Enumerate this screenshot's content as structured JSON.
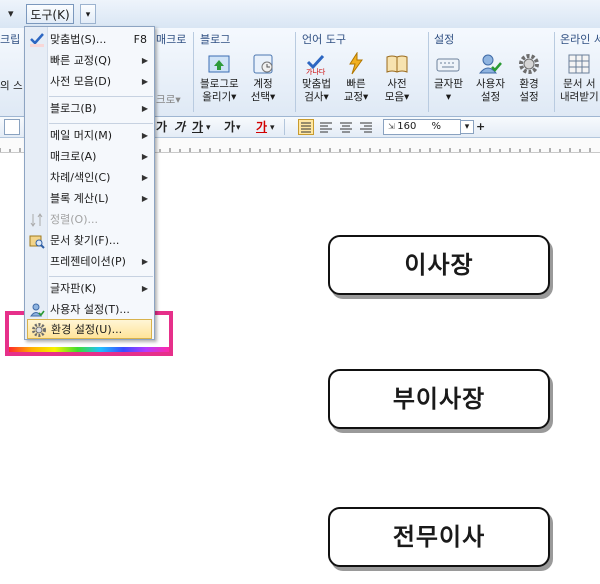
{
  "menubar": {
    "tool_menu": "도구(K)",
    "tool_drop": "▾",
    "left_arrow": "▾"
  },
  "ribbon": {
    "groups": {
      "script_partial": "크립",
      "macro_partial": "매크로",
      "blog": "블로그",
      "lang": "언어 도구",
      "settings": "설정",
      "online_partial": "온라인 서"
    },
    "partial_left_label": "의 스",
    "partial_macro_btn": "크로▾",
    "buttons": {
      "blog_post": [
        "블로그로",
        "올리기▾"
      ],
      "account": [
        "계정",
        "선택▾"
      ],
      "spell_check": [
        "맞춤법",
        "검사▾"
      ],
      "quick_fix": [
        "빠른",
        "교정▾"
      ],
      "dict": [
        "사전",
        "모음▾"
      ],
      "keyboard": [
        "글자판",
        "▾"
      ],
      "user_settings": [
        "사용자",
        "설정"
      ],
      "env_settings": [
        "환경",
        "설정"
      ],
      "doc_download": [
        "문서 서",
        "내려받기"
      ]
    }
  },
  "format_bar": {
    "ga1": "가",
    "ga2": "가",
    "ga_under": "가",
    "ga_dash": "가",
    "ga_red": "가",
    "zoom_value": "160",
    "zoom_unit": "%"
  },
  "dropdown": {
    "items": [
      {
        "label": "맞춤법(S)...",
        "shortcut": "F8",
        "icon": "spell-check-icon"
      },
      {
        "label": "빠른 교정(Q)",
        "submenu": true
      },
      {
        "label": "사전 모음(D)",
        "submenu": true
      },
      {
        "label": "블로그(B)",
        "submenu": true
      },
      {
        "label": "메일 머지(M)",
        "submenu": true
      },
      {
        "label": "매크로(A)",
        "submenu": true
      },
      {
        "label": "차례/색인(C)",
        "submenu": true
      },
      {
        "label": "블록 계산(L)",
        "submenu": true
      },
      {
        "label": "정렬(O)...",
        "disabled": true,
        "icon": "sort-icon"
      },
      {
        "label": "문서 찾기(F)...",
        "icon": "find-doc-icon"
      },
      {
        "label": "프레젠테이션(P)",
        "submenu": true
      },
      {
        "label": "글자판(K)",
        "submenu": true
      },
      {
        "label": "사용자 설정(T)...",
        "icon": "user-settings-icon"
      },
      {
        "label": "환경 설정(U)...",
        "icon": "settings-gear-icon",
        "highlighted": true
      }
    ]
  },
  "document": {
    "boxes": [
      "이사장",
      "부이사장",
      "전무이사"
    ]
  },
  "colors": {
    "highlight_frame": "#e6308a",
    "menu_highlight": "#ffe49a",
    "ribbon_bg": "#dfe9f5"
  }
}
